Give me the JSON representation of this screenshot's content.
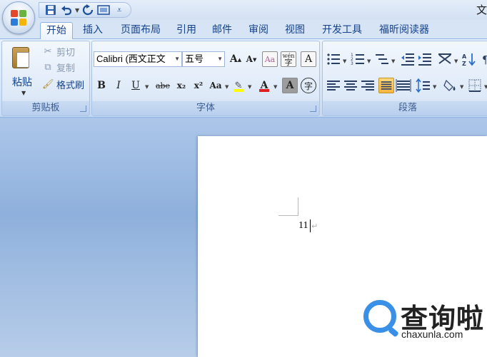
{
  "title_bar": {
    "title": "文"
  },
  "quick_access": {
    "items": [
      {
        "name": "save",
        "glyph": "💾"
      },
      {
        "name": "undo",
        "glyph": "↶"
      },
      {
        "name": "redo",
        "glyph": "↺"
      },
      {
        "name": "print-preview",
        "glyph": "▭"
      },
      {
        "name": "customize",
        "glyph": "⇣"
      }
    ]
  },
  "tabs": [
    "开始",
    "插入",
    "页面布局",
    "引用",
    "邮件",
    "审阅",
    "视图",
    "开发工具",
    "福昕阅读器"
  ],
  "active_tab": "开始",
  "clipboard": {
    "paste": "粘贴",
    "cut": "剪切",
    "copy": "复制",
    "format_painter": "格式刷",
    "group_label": "剪贴板"
  },
  "font": {
    "font_name": "Calibri (西文正文",
    "font_size": "五号",
    "group_label": "字体",
    "grow": "A",
    "shrink": "A",
    "phonetic": "wén",
    "bold": "B",
    "italic": "I",
    "underline": "U",
    "strikethrough": "abe",
    "subscript": "x₂",
    "superscript": "x²",
    "change_case": "Aa",
    "highlight_color": "#ffff00",
    "font_color": "#e02020",
    "font_color_glyph": "A",
    "char_shading": "A",
    "enclose": "字",
    "border_char": "A"
  },
  "paragraph": {
    "group_label": "段落"
  },
  "document": {
    "text": "11",
    "paragraph_mark": "↵"
  },
  "watermark": {
    "brand": "查询啦",
    "domain": "chaxunla.com"
  }
}
